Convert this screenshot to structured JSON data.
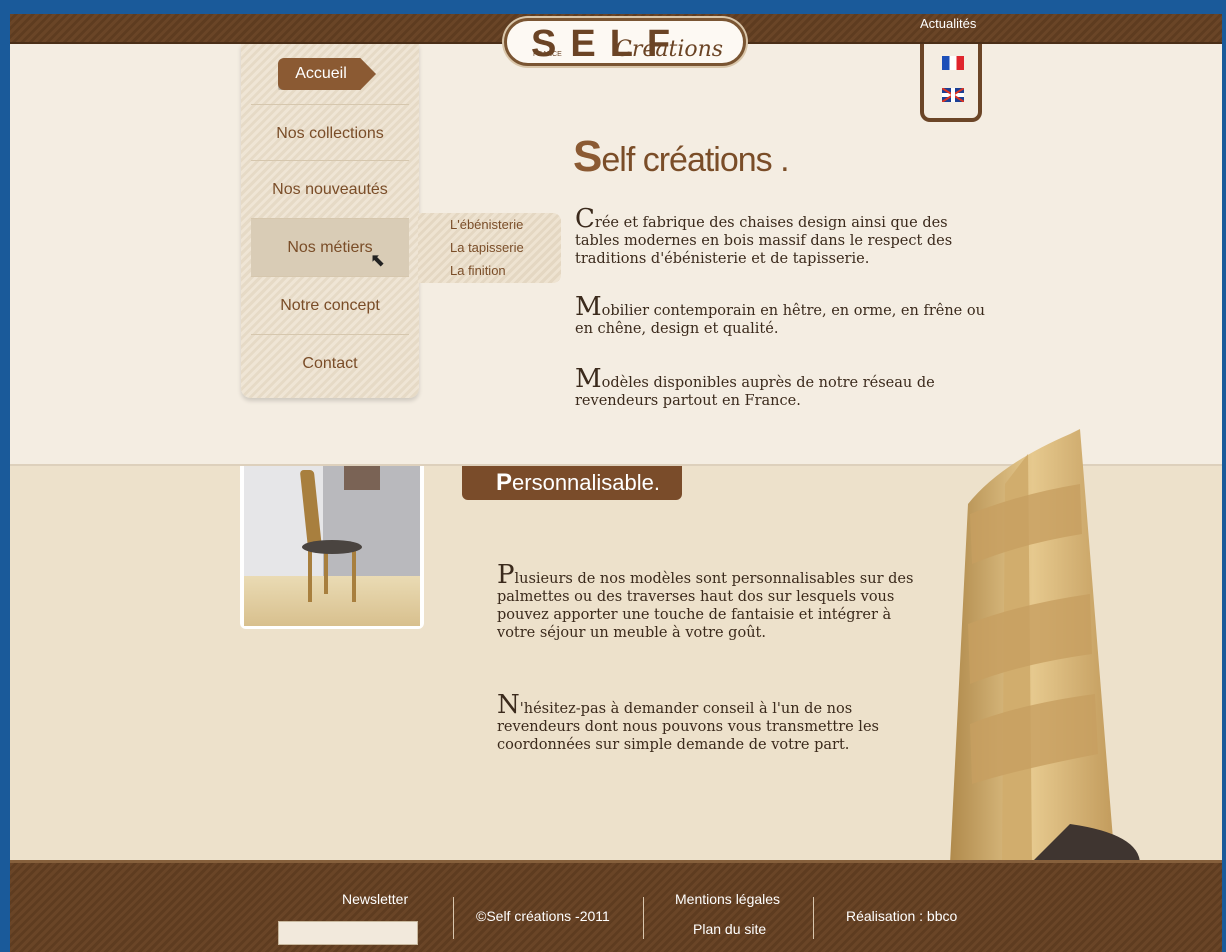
{
  "header": {
    "news_link": "Actualités",
    "logo": {
      "main": "SELF",
      "script": "Créations",
      "country": "FRANCE"
    },
    "languages": [
      {
        "name": "French",
        "icon": "flag-fr-icon"
      },
      {
        "name": "English",
        "icon": "flag-uk-icon"
      }
    ]
  },
  "nav": {
    "home": "Accueil",
    "items": [
      "Nos collections",
      "Nos nouveautés",
      "Nos métiers",
      "Notre concept",
      "Contact"
    ],
    "active_index": 2,
    "submenu": [
      "L'ébénisterie",
      "La tapisserie",
      "La finition"
    ]
  },
  "intro": {
    "title_cap": "S",
    "title_rest": "elf créations .",
    "paragraphs": [
      {
        "cap": "C",
        "text": "rée et fabrique des chaises design ainsi que des tables modernes en bois massif dans le respect des traditions d'ébénisterie et de tapisserie."
      },
      {
        "cap": "M",
        "text": "obilier contemporain en hêtre, en orme, en frêne ou en chêne, design et qualité."
      },
      {
        "cap": "M",
        "text": "odèles disponibles auprès de notre réseau de revendeurs partout en France."
      }
    ]
  },
  "section": {
    "banner_cap": "P",
    "banner_rest": "ersonnalisable.",
    "paragraphs": [
      {
        "cap": "P",
        "text": "lusieurs de nos modèles sont personnalisables sur des palmettes ou des traverses haut dos sur lesquels vous pouvez apporter une touche de fantaisie et intégrer à votre séjour un meuble à votre goût."
      },
      {
        "cap": "N",
        "text": "'hésitez-pas à demander conseil à l'un de nos revendeurs dont nous pouvons vous transmettre les coordonnées sur simple demande de votre part."
      }
    ]
  },
  "footer": {
    "newsletter": "Newsletter",
    "copyright": "©Self créations -2011",
    "legal": "Mentions légales",
    "sitemap": "Plan du site",
    "credit": "Réalisation : bbco"
  },
  "colors": {
    "brand_brown": "#7a4d28",
    "dark_bar": "#5e3c20",
    "background": "#ede1cb"
  }
}
